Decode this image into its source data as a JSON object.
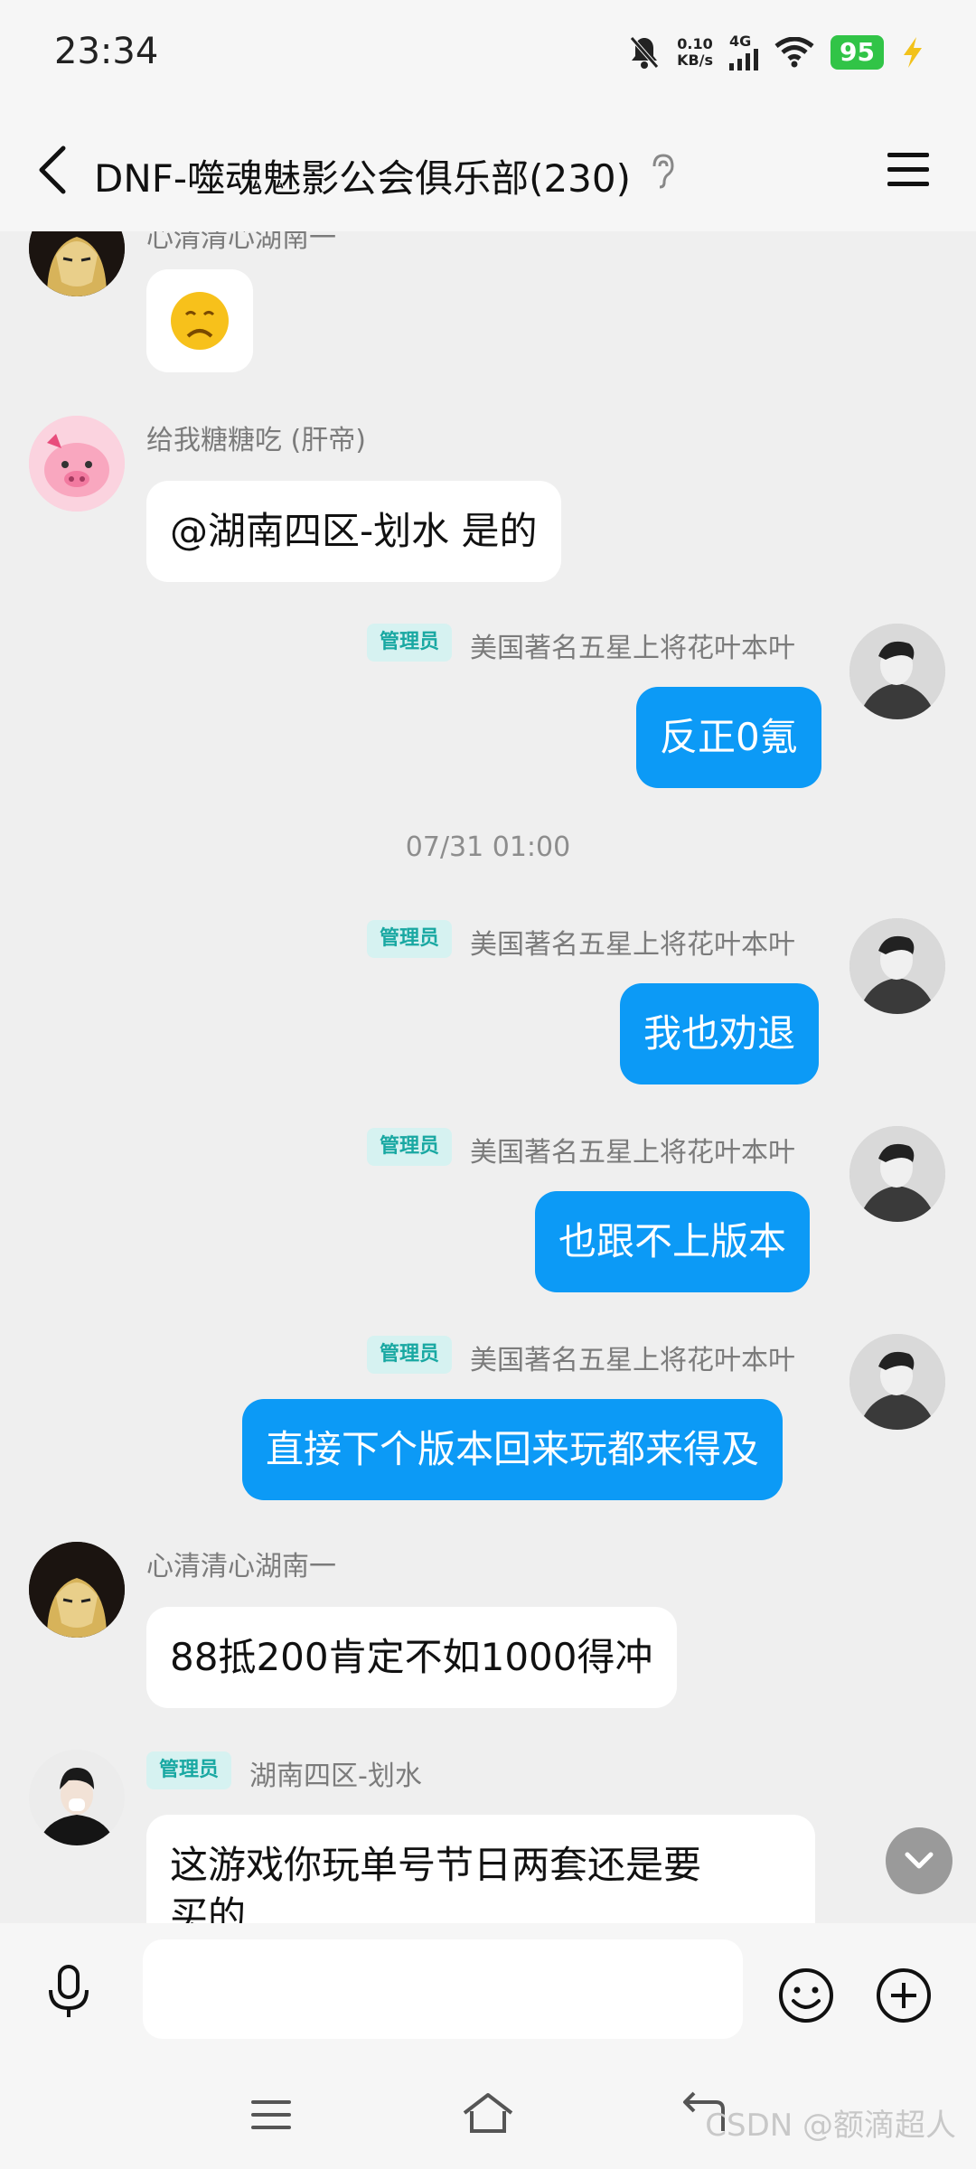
{
  "status": {
    "time": "23:34",
    "net_speed_value": "0.10",
    "net_speed_unit": "KB/s",
    "network": "4G",
    "battery": "95"
  },
  "header": {
    "title": "DNF-噬魂魅影公会俱乐部(230)"
  },
  "chat": {
    "msg1": {
      "name": "心清清心湖南一",
      "emoji": "☹"
    },
    "msg2": {
      "name": "给我糖糖吃 (肝帝)",
      "text": "@湖南四区-划水 是的"
    },
    "msg3": {
      "badge": "管理员",
      "name": "美国著名五星上将花叶本叶",
      "text": "反正0氪"
    },
    "timestamp": "07/31 01:00",
    "msg4": {
      "badge": "管理员",
      "name": "美国著名五星上将花叶本叶",
      "text": "我也劝退"
    },
    "msg5": {
      "badge": "管理员",
      "name": "美国著名五星上将花叶本叶",
      "text": "也跟不上版本"
    },
    "msg6": {
      "badge": "管理员",
      "name": "美国著名五星上将花叶本叶",
      "text": "直接下个版本回来玩都来得及"
    },
    "msg7": {
      "name": "心清清心湖南一",
      "text": "88抵200肯定不如1000得冲"
    },
    "msg8": {
      "badge": "管理员",
      "name": "湖南四区-划水",
      "text_line1": "这游戏你玩单号节日两套还是要",
      "text_line2": "买的"
    }
  },
  "watermark": "CSDN @额滴超人",
  "colors": {
    "accent": "#0c9af6",
    "badge_bg": "#d6f2f1",
    "badge_text": "#19a8a2",
    "battery": "#31c447"
  }
}
